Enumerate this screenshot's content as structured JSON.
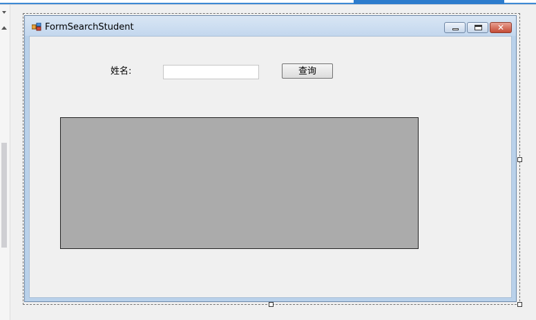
{
  "form": {
    "title": "FormSearchStudent",
    "name_label": "姓名:",
    "name_input_value": "",
    "query_button_label": "查询",
    "window_buttons": {
      "minimize_icon": "minimize-icon",
      "maximize_icon": "maximize-icon",
      "close_icon": "close-icon"
    }
  },
  "colors": {
    "title_bar": "#c3d7ee",
    "form_border": "#b9d1ea",
    "grid_background": "#ababab",
    "close_button": "#c44b35",
    "designer_tab_active": "#2d7ccd"
  }
}
